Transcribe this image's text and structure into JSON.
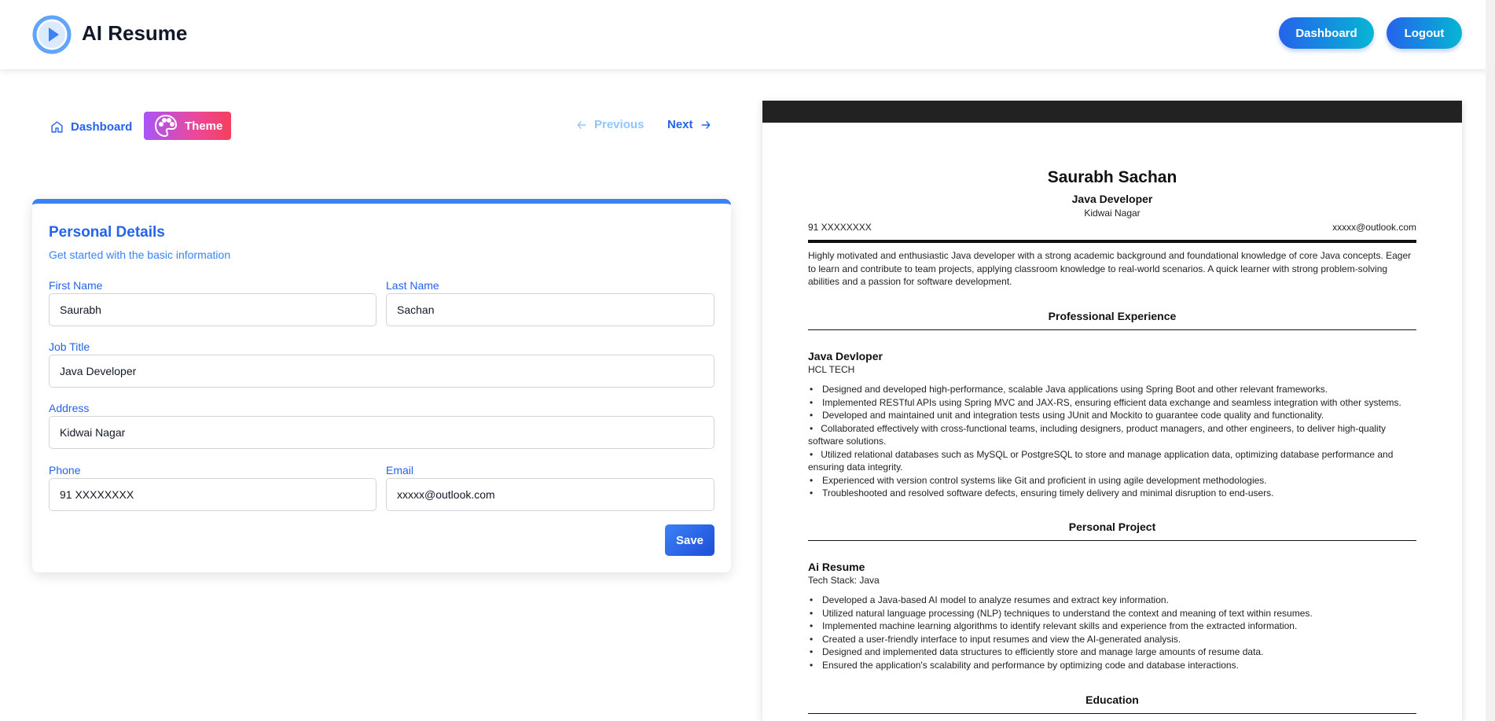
{
  "header": {
    "brand": "AI Resume",
    "dashboard_label": "Dashboard",
    "logout_label": "Logout"
  },
  "toolbar": {
    "dashboard_label": "Dashboard",
    "theme_label": "Theme",
    "previous_label": "Previous",
    "next_label": "Next"
  },
  "form": {
    "title": "Personal Details",
    "subtitle": "Get started with the basic information",
    "first_name": {
      "label": "First Name",
      "value": "Saurabh"
    },
    "last_name": {
      "label": "Last Name",
      "value": "Sachan"
    },
    "job_title": {
      "label": "Job Title",
      "value": "Java Developer"
    },
    "address": {
      "label": "Address",
      "value": "Kidwai Nagar"
    },
    "phone": {
      "label": "Phone",
      "value": "91 XXXXXXXX"
    },
    "email": {
      "label": "Email",
      "value": "xxxxx@outlook.com"
    },
    "save_label": "Save"
  },
  "resume": {
    "name": "Saurabh Sachan",
    "job_title": "Java Developer",
    "address": "Kidwai Nagar",
    "phone": "91 XXXXXXXX",
    "email": "xxxxx@outlook.com",
    "summary": "Highly motivated and enthusiastic Java developer with a strong academic background and foundational knowledge of core Java concepts. Eager to learn and contribute to team projects, applying classroom knowledge to real-world scenarios. A quick learner with strong problem-solving abilities and a passion for software development.",
    "experience_heading": "Professional Experience",
    "experience": {
      "title": "Java Devloper",
      "company": "HCL TECH",
      "bullets": [
        "Designed and developed high-performance, scalable Java applications using Spring Boot and other relevant frameworks.",
        "Implemented RESTful APIs using Spring MVC and JAX-RS, ensuring efficient data exchange and seamless integration with other systems.",
        "Developed and maintained unit and integration tests using JUnit and Mockito to guarantee code quality and functionality.",
        "Collaborated effectively with cross-functional teams, including designers, product managers, and other engineers, to deliver high-quality software solutions.",
        "Utilized relational databases such as MySQL or PostgreSQL to store and manage application data, optimizing database performance and ensuring data integrity.",
        "Experienced with version control systems like Git and proficient in using agile development methodologies.",
        "Troubleshooted and resolved software defects, ensuring timely delivery and minimal disruption to end-users."
      ]
    },
    "project_heading": "Personal Project",
    "project": {
      "title": "Ai Resume",
      "stack": "Tech Stack: Java",
      "bullets": [
        "Developed a Java-based AI model to analyze resumes and extract key information.",
        "Utilized natural language processing (NLP) techniques to understand the context and meaning of text within resumes.",
        "Implemented machine learning algorithms to identify relevant skills and experience from the extracted information.",
        "Created a user-friendly interface to input resumes and view the AI-generated analysis.",
        "Designed and implemented data structures to efficiently store and manage large amounts of resume data.",
        "Ensured the application's scalability and performance by optimizing code and database interactions."
      ]
    },
    "education_heading": "Education"
  },
  "colors": {
    "accent": "#2563eb",
    "theme_gradient_start": "#a855f7",
    "theme_gradient_end": "#f43f5e",
    "resume_bar": "#222222"
  },
  "icons": {
    "logo": "play-circle-icon",
    "dashboard": "home-icon",
    "theme": "palette-icon",
    "previous": "arrow-left-icon",
    "next": "arrow-right-icon"
  }
}
